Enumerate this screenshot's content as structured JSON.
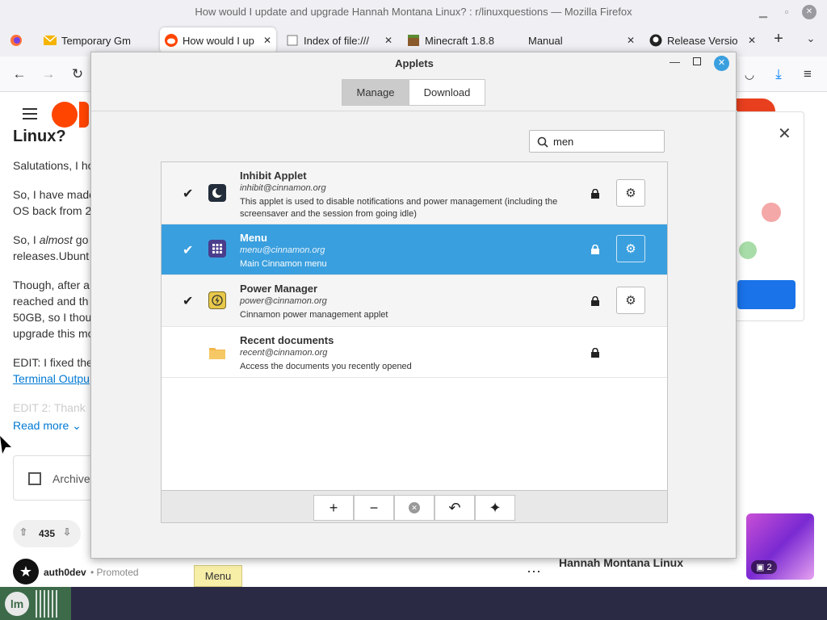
{
  "window": {
    "title": "How would I update and upgrade Hannah Montana Linux? : r/linuxquestions — Mozilla Firefox"
  },
  "tabs": [
    {
      "label": "Temporary Gm"
    },
    {
      "label": "How would I up"
    },
    {
      "label": "Index of file:///"
    },
    {
      "label": "Minecraft 1.8.8"
    },
    {
      "label": "Manual"
    },
    {
      "label": "Release Versio"
    }
  ],
  "page": {
    "heading_fragment": "Linux?",
    "p1": "Salutations, I ho",
    "p2a": "So, I have made",
    "p2b": "OS back from 2",
    "p3a_pre": "So, I ",
    "p3a_em": "almost",
    "p3a_post": " go",
    "p3b": "releases.Ubunt",
    "p4a": "Though, after a",
    "p4b": "reached and th",
    "p4c": "50GB, so I thou",
    "p4d": "upgrade this mo",
    "edit": "EDIT: I fixed the",
    "terminal_link": "Terminal Outpu",
    "edit2": "EDIT 2: Thank",
    "read_more": "Read more",
    "archive": "Archive",
    "votes": "435",
    "promoted_user": "auth0dev",
    "promoted_label": "Promoted",
    "sidebar_title": "Hannah Montana Linux",
    "gallery_count": "2",
    "tooltip": "Menu"
  },
  "dialog": {
    "title": "Applets",
    "tabs": {
      "manage": "Manage",
      "download": "Download"
    },
    "search_value": "men",
    "applets": [
      {
        "name": "Inhibit Applet",
        "uuid": "inhibit@cinnamon.org",
        "desc": "This applet is used to disable notifications and power management (including the screensaver and the session from going idle)"
      },
      {
        "name": "Menu",
        "uuid": "menu@cinnamon.org",
        "desc": "Main Cinnamon menu"
      },
      {
        "name": "Power Manager",
        "uuid": "power@cinnamon.org",
        "desc": "Cinnamon power management applet"
      },
      {
        "name": "Recent documents",
        "uuid": "recent@cinnamon.org",
        "desc": "Access the documents you recently opened"
      }
    ]
  },
  "colors": {
    "selection": "#3a9fde",
    "reddit": "#ff4500",
    "taskbar": "#2b2a45",
    "link": "#0079d3"
  }
}
